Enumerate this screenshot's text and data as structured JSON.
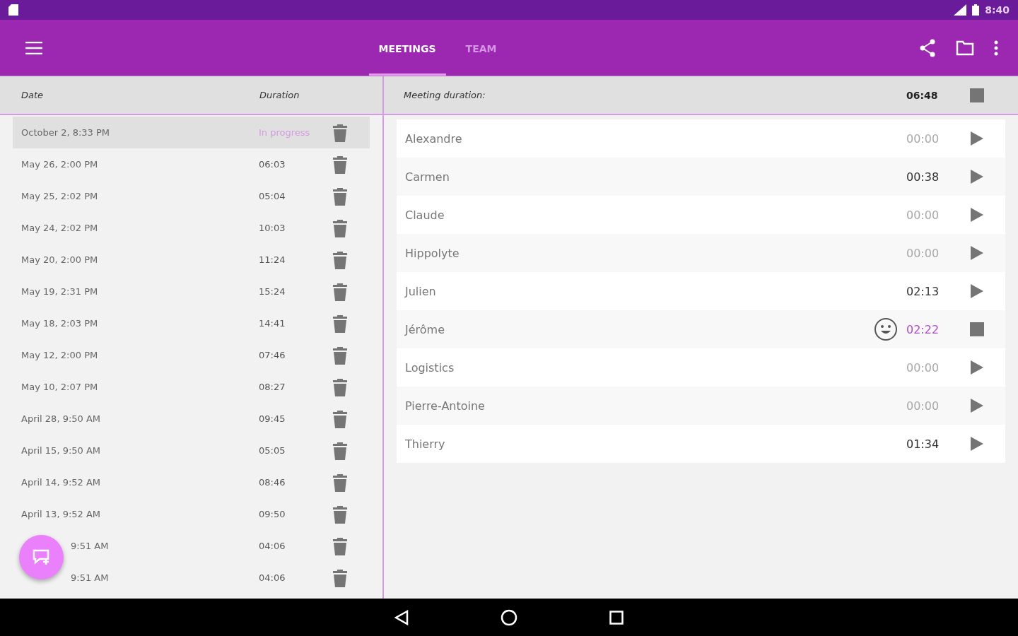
{
  "status_bar": {
    "time": "8:40"
  },
  "tabs": [
    {
      "label": "MEETINGS",
      "selected": true
    },
    {
      "label": "TEAM",
      "selected": false
    }
  ],
  "meetings": {
    "columns": [
      "Date",
      "Duration"
    ],
    "rows": [
      {
        "date": "October 2, 8:33 PM",
        "duration": "In progress",
        "selected": true,
        "in_progress": true,
        "covered": false
      },
      {
        "date": "May 26, 2:00 PM",
        "duration": "06:03",
        "selected": false,
        "in_progress": false,
        "covered": false
      },
      {
        "date": "May 25, 2:02 PM",
        "duration": "05:04",
        "selected": false,
        "in_progress": false,
        "covered": false
      },
      {
        "date": "May 24, 2:02 PM",
        "duration": "10:03",
        "selected": false,
        "in_progress": false,
        "covered": false
      },
      {
        "date": "May 20, 2:00 PM",
        "duration": "11:24",
        "selected": false,
        "in_progress": false,
        "covered": false
      },
      {
        "date": "May 19, 2:31 PM",
        "duration": "15:24",
        "selected": false,
        "in_progress": false,
        "covered": false
      },
      {
        "date": "May 18, 2:03 PM",
        "duration": "14:41",
        "selected": false,
        "in_progress": false,
        "covered": false
      },
      {
        "date": "May 12, 2:00 PM",
        "duration": "07:46",
        "selected": false,
        "in_progress": false,
        "covered": false
      },
      {
        "date": "May 10, 2:07 PM",
        "duration": "08:27",
        "selected": false,
        "in_progress": false,
        "covered": false
      },
      {
        "date": "April 28, 9:50 AM",
        "duration": "09:45",
        "selected": false,
        "in_progress": false,
        "covered": false
      },
      {
        "date": "April 15, 9:50 AM",
        "duration": "05:05",
        "selected": false,
        "in_progress": false,
        "covered": false
      },
      {
        "date": "April 14, 9:52 AM",
        "duration": "08:46",
        "selected": false,
        "in_progress": false,
        "covered": false
      },
      {
        "date": "April 13, 9:52 AM",
        "duration": "09:50",
        "selected": false,
        "in_progress": false,
        "covered": false
      },
      {
        "date": "9:51 AM",
        "duration": "04:06",
        "selected": false,
        "in_progress": false,
        "covered": true
      },
      {
        "date": "9:51 AM",
        "duration": "04:06",
        "selected": false,
        "in_progress": false,
        "covered": true
      }
    ]
  },
  "meeting": {
    "label": "Meeting duration:",
    "duration": "06:48",
    "running": true
  },
  "participants": [
    {
      "name": "Alexandre",
      "time": "00:00",
      "speaking": false,
      "muted": true
    },
    {
      "name": "Carmen",
      "time": "00:38",
      "speaking": false,
      "muted": false
    },
    {
      "name": "Claude",
      "time": "00:00",
      "speaking": false,
      "muted": true
    },
    {
      "name": "Hippolyte",
      "time": "00:00",
      "speaking": false,
      "muted": true
    },
    {
      "name": "Julien",
      "time": "02:13",
      "speaking": false,
      "muted": false
    },
    {
      "name": "Jérôme",
      "time": "02:22",
      "speaking": true,
      "muted": false
    },
    {
      "name": "Logistics",
      "time": "00:00",
      "speaking": false,
      "muted": true
    },
    {
      "name": "Pierre-Antoine",
      "time": "00:00",
      "speaking": false,
      "muted": true
    },
    {
      "name": "Thierry",
      "time": "01:34",
      "speaking": false,
      "muted": false
    }
  ]
}
